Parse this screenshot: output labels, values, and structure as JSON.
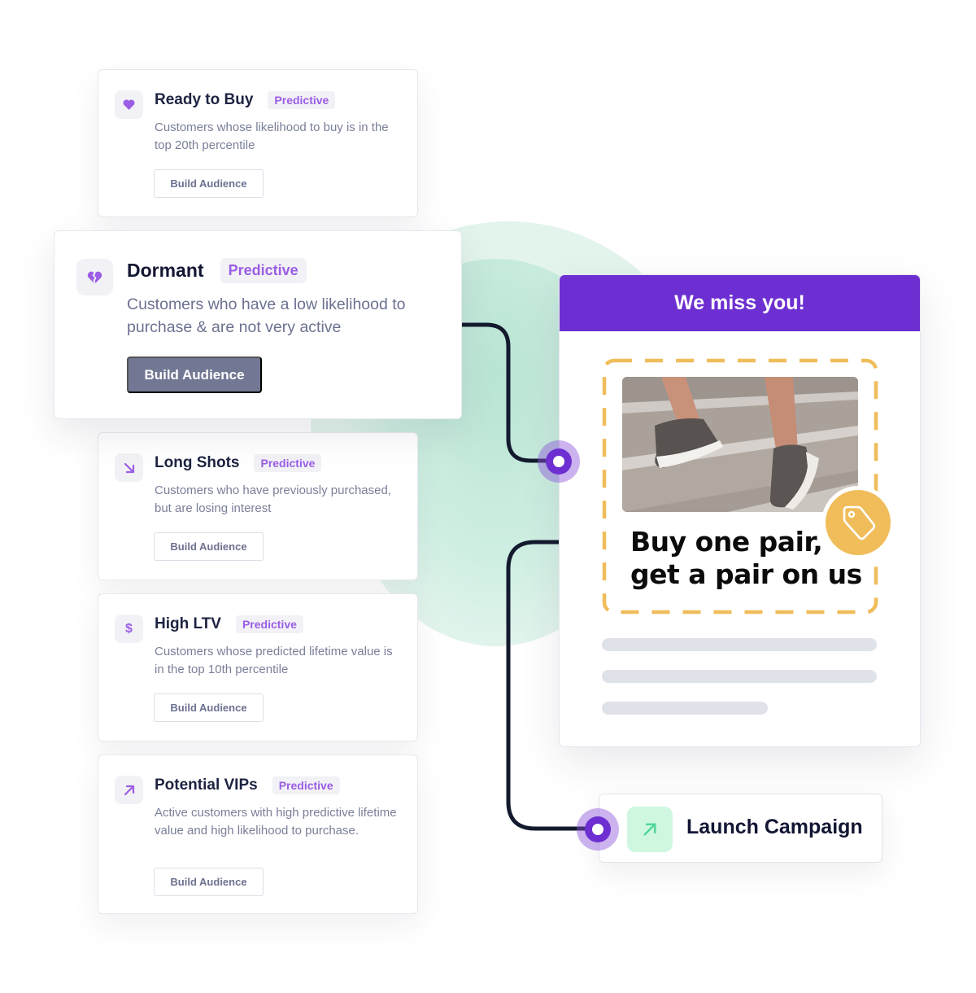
{
  "segments": [
    {
      "title": "Ready to Buy",
      "badge": "Predictive",
      "description": "Customers whose likelihood to buy is in the top 20th percentile",
      "button": "Build Audience",
      "icon": "heart-icon"
    },
    {
      "title": "Dormant",
      "badge": "Predictive",
      "description": "Customers who have a low likelihood to purchase & are not very active",
      "button": "Build Audience",
      "icon": "broken-heart-icon",
      "selected": true
    },
    {
      "title": "Long Shots",
      "badge": "Predictive",
      "description": "Customers who have previously purchased, but are losing interest",
      "button": "Build Audience",
      "icon": "arrow-down-right-icon"
    },
    {
      "title": "High LTV",
      "badge": "Predictive",
      "description": "Customers whose predicted lifetime value is in the top 10th percentile",
      "button": "Build Audience",
      "icon": "dollar-icon"
    },
    {
      "title": "Potential VIPs",
      "badge": "Predictive",
      "description": "Active customers with high predictive lifetime value and high likelihood to purchase.",
      "button": "Build Audience",
      "icon": "arrow-up-right-icon"
    }
  ],
  "email": {
    "header": "We miss you!",
    "coupon_line1": "Buy one pair,",
    "coupon_line2": "get a pair on us",
    "image": "sneakers-on-stairs-photo",
    "tag_icon": "price-tag-icon"
  },
  "launch": {
    "label": "Launch Campaign",
    "icon": "arrow-up-right-icon"
  },
  "colors": {
    "brand_purple": "#6d2fd1",
    "badge_purple": "#9b5de5",
    "coupon_yellow": "#f0bd5a",
    "launch_green": "#cff7e0",
    "dark_button": "#727893",
    "connector": "#131a2e"
  }
}
